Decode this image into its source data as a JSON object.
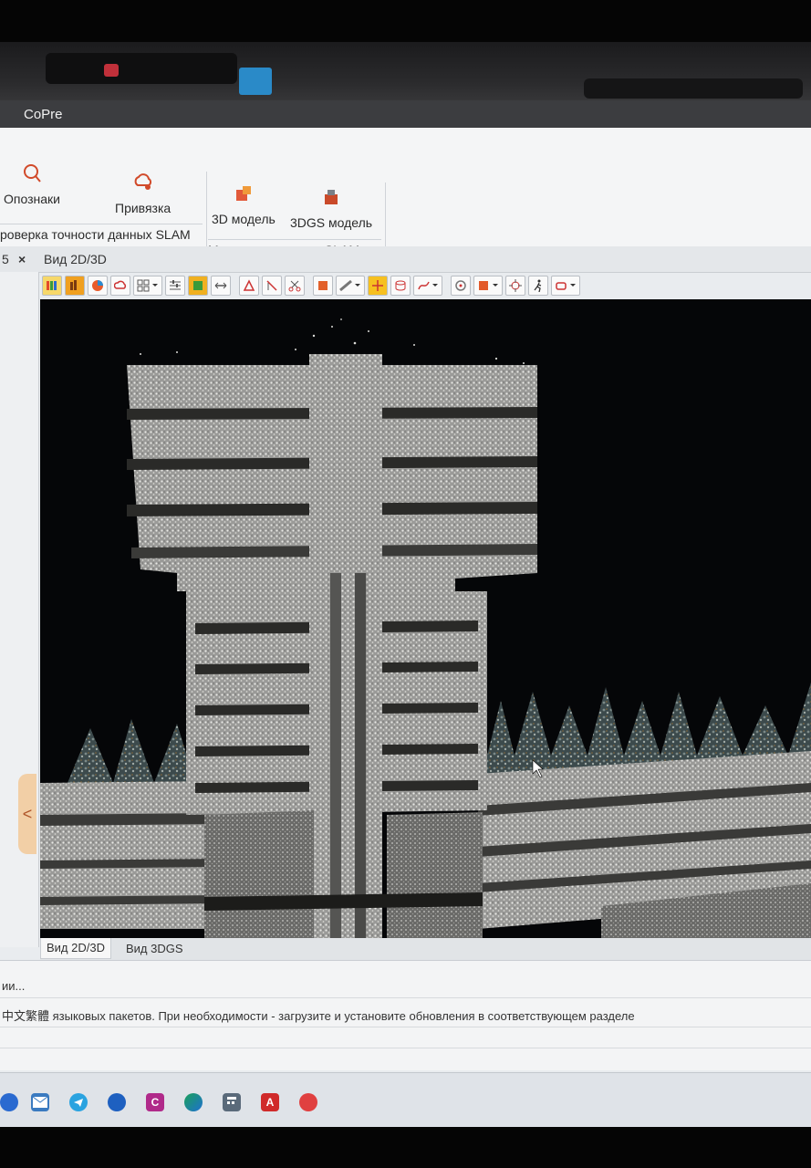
{
  "window": {
    "title": "CoPre"
  },
  "ribbon": {
    "markers_label": "Опознаки",
    "binding_label": "Привязка",
    "group_slam_accuracy": "роверка точности данных SLAM",
    "model3d_label": "3D модель",
    "model3dgs_label": "3DGS модель",
    "group_slam_modeling": "Моделирование по SLAM"
  },
  "doc_tabs": {
    "pin_glyph": "5",
    "close_glyph": "×",
    "active": "Вид 2D/3D"
  },
  "view_tabs": {
    "tab_2d3d": "Вид 2D/3D",
    "tab_3dgs": "Вид 3DGS"
  },
  "log": {
    "line1": "ии...",
    "line2": "中文繁體 языковых пакетов. При необходимости - загрузите и установите обновления в соответствующем разделе"
  },
  "left_panel": {
    "collapse_glyph": "<"
  },
  "taskbar": {
    "app_c": "C",
    "app_a": "A"
  },
  "colors": {
    "accent": "#f0a020",
    "viewport_bg": "#050608",
    "title_bar": "#3c3d40"
  }
}
